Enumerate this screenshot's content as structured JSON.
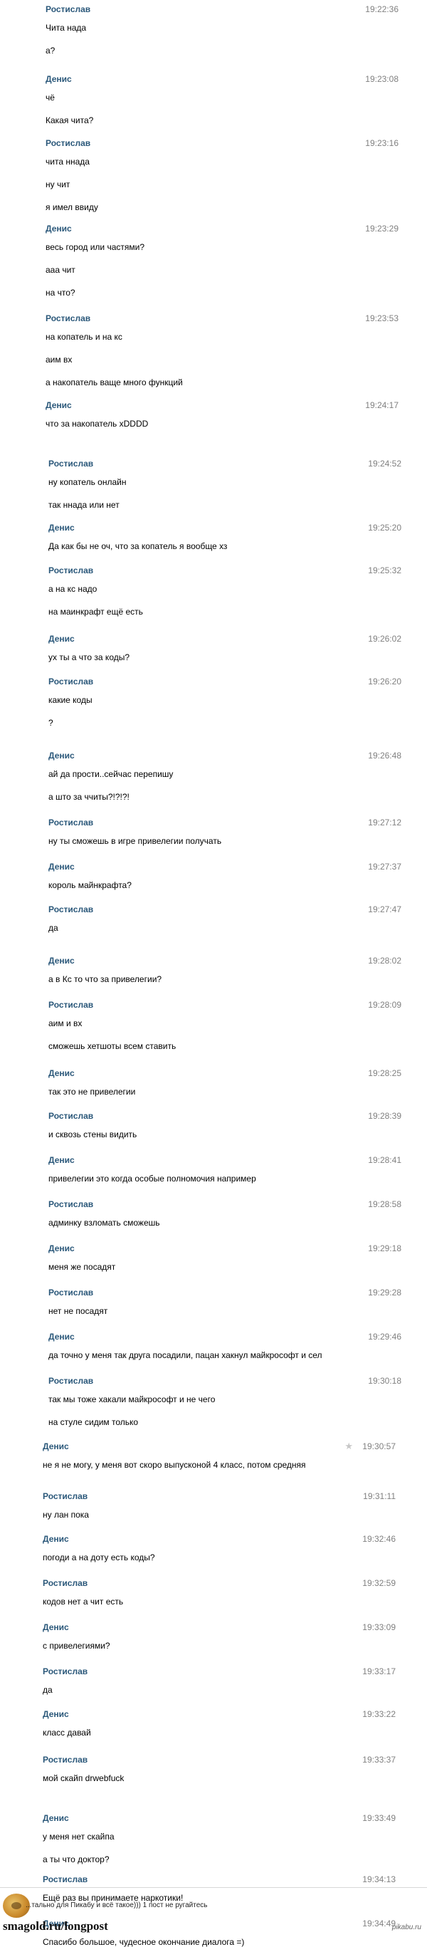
{
  "conversation": [
    {
      "sender": "Ростислав",
      "time": "19:22:36",
      "lines": [
        "Чита нада",
        "а?"
      ]
    },
    {
      "sender": "Денис",
      "time": "19:23:08",
      "lines": [
        "чё",
        "Какая чита?"
      ]
    },
    {
      "sender": "Ростислав",
      "time": "19:23:16",
      "lines": [
        "чита ннада",
        "ну чит",
        "я имел ввиду"
      ]
    },
    {
      "sender": "Денис",
      "time": "19:23:29",
      "lines": [
        "весь город или частями?",
        "ааа чит",
        "на что?"
      ]
    },
    {
      "sender": "Ростислав",
      "time": "19:23:53",
      "lines": [
        "на копатель и на кс",
        "аим вх",
        "а накопатель ваще много функций"
      ]
    },
    {
      "sender": "Денис",
      "time": "19:24:17",
      "lines": [
        "что за накопатель xDDDD"
      ]
    },
    {
      "sender": "Ростислав",
      "time": "19:24:52",
      "lines": [
        "ну копатель онлайн",
        "так ннада или нет"
      ]
    },
    {
      "sender": "Денис",
      "time": "19:25:20",
      "lines": [
        "Да как бы не оч, что за копатель я вообще хз"
      ]
    },
    {
      "sender": "Ростислав",
      "time": "19:25:32",
      "lines": [
        "а на кс надо",
        "на маинкрафт ещё есть"
      ]
    },
    {
      "sender": "Денис",
      "time": "19:26:02",
      "lines": [
        "ух ты а что за коды?"
      ]
    },
    {
      "sender": "Ростислав",
      "time": "19:26:20",
      "lines": [
        "какие коды",
        "?"
      ]
    },
    {
      "sender": "Денис",
      "time": "19:26:48",
      "lines": [
        "ай да прости..сейчас перепишу",
        "а што за ччиты?!?!?!"
      ]
    },
    {
      "sender": "Ростислав",
      "time": "19:27:12",
      "lines": [
        "ну ты сможешь в игре привелегии получать"
      ]
    },
    {
      "sender": "Денис",
      "time": "19:27:37",
      "lines": [
        "король майнкрафта?"
      ]
    },
    {
      "sender": "Ростислав",
      "time": "19:27:47",
      "lines": [
        "да"
      ]
    },
    {
      "sender": "Денис",
      "time": "19:28:02",
      "lines": [
        "а в Кс то что за привелегии?"
      ]
    },
    {
      "sender": "Ростислав",
      "time": "19:28:09",
      "lines": [
        "аим и вх",
        "сможешь хетшоты всем ставить"
      ]
    },
    {
      "sender": "Денис",
      "time": "19:28:25",
      "lines": [
        "так это не привелегии"
      ]
    },
    {
      "sender": "Ростислав",
      "time": "19:28:39",
      "lines": [
        "и сквозь стены видить"
      ]
    },
    {
      "sender": "Денис",
      "time": "19:28:41",
      "lines": [
        "привелегии это когда особые полномочия например"
      ]
    },
    {
      "sender": "Ростислав",
      "time": "19:28:58",
      "lines": [
        "админку взломать сможешь"
      ]
    },
    {
      "sender": "Денис",
      "time": "19:29:18",
      "lines": [
        "меня же посадят"
      ]
    },
    {
      "sender": "Ростислав",
      "time": "19:29:28",
      "lines": [
        "нет не посадят"
      ]
    },
    {
      "sender": "Денис",
      "time": "19:29:46",
      "lines": [
        "да точно у меня так друга посадили, пацан хакнул майкрософт и сел"
      ]
    },
    {
      "sender": "Ростислав",
      "time": "19:30:18",
      "lines": [
        "так мы тоже хакали майкрософт и не чего",
        "на стуле сидим только"
      ]
    },
    {
      "sender": "Денис",
      "time": "19:30:57",
      "lines": [
        "не я не могу, у меня вот скоро выпусконой 4 класс, потом средняя"
      ]
    },
    {
      "sender": "Ростислав",
      "time": "19:31:11",
      "lines": [
        "ну лан пока"
      ]
    },
    {
      "sender": "Денис",
      "time": "19:32:46",
      "lines": [
        "погоди а на доту есть коды?"
      ]
    },
    {
      "sender": "Ростислав",
      "time": "19:32:59",
      "lines": [
        "кодов нет а чит есть"
      ]
    },
    {
      "sender": "Денис",
      "time": "19:33:09",
      "lines": [
        "с привелегиями?"
      ]
    },
    {
      "sender": "Ростислав",
      "time": "19:33:17",
      "lines": [
        "да"
      ]
    },
    {
      "sender": "Денис",
      "time": "19:33:22",
      "lines": [
        "класс давай"
      ]
    },
    {
      "sender": "Ростислав",
      "time": "19:33:37",
      "lines": [
        "мой скайп drwebfuck"
      ]
    },
    {
      "sender": "Денис",
      "time": "19:33:49",
      "lines": [
        "у меня нет скайпа",
        "а ты что доктор?"
      ]
    },
    {
      "sender": "Ростислав",
      "time": "19:34:13",
      "lines": [
        "Ещё раз вы принимаете наркотики!"
      ]
    },
    {
      "sender": "Денис",
      "time": "19:34:49",
      "lines": [
        "Спасибо большое, чудесное окончание диалога =)"
      ]
    }
  ],
  "footer": {
    "caption": "...тально для Пикабу и всё такое))) 1 пост не ругайтесь",
    "site": "smagold.ru/longpost",
    "watermark": "pikabu.ru"
  }
}
